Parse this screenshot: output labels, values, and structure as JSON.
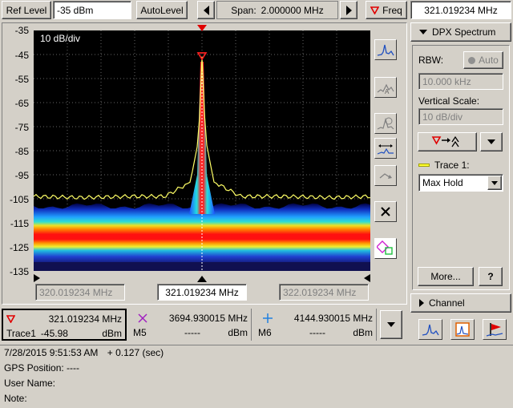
{
  "toolbar": {
    "ref_level_label": "Ref Level",
    "ref_level_value": "-35 dBm",
    "autolevel_label": "AutoLevel",
    "span_label": "Span:",
    "span_value": "2.000000 MHz",
    "freq_label": "Freq",
    "freq_value": "321.019234 MHz"
  },
  "plot": {
    "scale_label": "10 dB/div",
    "y_ticks": [
      "-35",
      "-45",
      "-55",
      "-65",
      "-75",
      "-85",
      "-95",
      "-105",
      "-115",
      "-125",
      "-135"
    ],
    "x_left": "320.019234 MHz",
    "x_center": "321.019234 MHz",
    "x_right": "322.019234 MHz"
  },
  "chart_data": {
    "type": "line",
    "ylim": [
      -135,
      -35
    ],
    "xlim_mhz": [
      320.019234,
      322.019234
    ],
    "center_mhz": 321.019234,
    "series": [
      {
        "name": "Trace 1",
        "mode": "Max Hold",
        "color": "#ffff66",
        "x": [
          320.019234,
          320.3,
          320.6,
          320.8,
          320.95,
          321.0,
          321.019234,
          321.04,
          321.09,
          321.25,
          321.5,
          321.8,
          322.019234
        ],
        "y": [
          -104,
          -104.5,
          -104,
          -104,
          -98,
          -80,
          -45.98,
          -80,
          -98,
          -104,
          -104,
          -104.5,
          -104
        ]
      }
    ],
    "background_band_dbm": [
      -108,
      -130
    ],
    "peak_dbm": -45.98
  },
  "markers": [
    {
      "id": "trace1",
      "freq": "321.019234 MHz",
      "name": "Trace1",
      "value": "-45.98",
      "unit": "dBm",
      "symbol_color": "#e00000"
    },
    {
      "id": "m5",
      "freq": "3694.930015 MHz",
      "name": "M5",
      "value": "-----",
      "unit": "dBm",
      "symbol_color": "#a020c0"
    },
    {
      "id": "m6",
      "freq": "4144.930015 MHz",
      "name": "M6",
      "value": "-----",
      "unit": "dBm",
      "symbol_color": "#2080e0"
    }
  ],
  "panel": {
    "section_title": "DPX Spectrum",
    "rbw_label": "RBW:",
    "auto_label": "Auto",
    "rbw_value": "10.000 kHz",
    "vscale_label": "Vertical Scale:",
    "vscale_value": "10 dB/div",
    "trace_label": "Trace 1:",
    "trace_mode": "Max Hold",
    "more_label": "More...",
    "help_label": "?",
    "channel_title": "Channel"
  },
  "status": {
    "timestamp": "7/28/2015 9:51:53 AM",
    "offset": "+ 0.127 (sec)",
    "gps": "GPS Position: ----",
    "user": "User Name:",
    "note": "Note:"
  }
}
